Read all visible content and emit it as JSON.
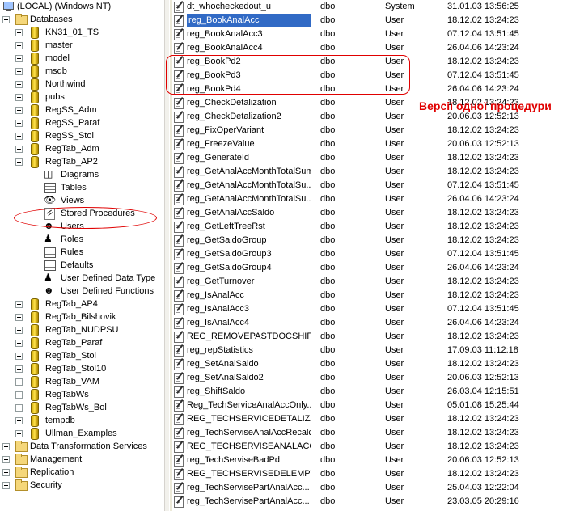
{
  "tree": {
    "items": [
      {
        "label": "(LOCAL) (Windows NT)",
        "icon": "monitor",
        "level": 0,
        "expander": "none"
      },
      {
        "label": "Databases",
        "icon": "folder",
        "level": 1,
        "expander": "minus"
      },
      {
        "label": "KN31_01_TS",
        "icon": "database",
        "level": 2,
        "expander": "plus"
      },
      {
        "label": "master",
        "icon": "database",
        "level": 2,
        "expander": "plus"
      },
      {
        "label": "model",
        "icon": "database",
        "level": 2,
        "expander": "plus"
      },
      {
        "label": "msdb",
        "icon": "database",
        "level": 2,
        "expander": "plus"
      },
      {
        "label": "Northwind",
        "icon": "database",
        "level": 2,
        "expander": "plus"
      },
      {
        "label": "pubs",
        "icon": "database",
        "level": 2,
        "expander": "plus"
      },
      {
        "label": "RegSS_Adm",
        "icon": "database",
        "level": 2,
        "expander": "plus"
      },
      {
        "label": "RegSS_Paraf",
        "icon": "database",
        "level": 2,
        "expander": "plus"
      },
      {
        "label": "RegSS_Stol",
        "icon": "database",
        "level": 2,
        "expander": "plus"
      },
      {
        "label": "RegTab_Adm",
        "icon": "database",
        "level": 2,
        "expander": "plus"
      },
      {
        "label": "RegTab_AP2",
        "icon": "database",
        "level": 2,
        "expander": "minus"
      },
      {
        "label": "Diagrams",
        "icon": "diagram",
        "level": 3,
        "expander": "none"
      },
      {
        "label": "Tables",
        "icon": "table",
        "level": 3,
        "expander": "none"
      },
      {
        "label": "Views",
        "icon": "views",
        "level": 3,
        "expander": "none"
      },
      {
        "label": "Stored Procedures",
        "icon": "stored-procedure",
        "level": 3,
        "expander": "none"
      },
      {
        "label": "Users",
        "icon": "users",
        "level": 3,
        "expander": "none"
      },
      {
        "label": "Roles",
        "icon": "roles",
        "level": 3,
        "expander": "none"
      },
      {
        "label": "Rules",
        "icon": "rules",
        "level": 3,
        "expander": "none"
      },
      {
        "label": "Defaults",
        "icon": "defaults",
        "level": 3,
        "expander": "none"
      },
      {
        "label": "User Defined Data Type",
        "icon": "udt",
        "level": 3,
        "expander": "none"
      },
      {
        "label": "User Defined Functions",
        "icon": "udf",
        "level": 3,
        "expander": "none"
      },
      {
        "label": "RegTab_AP4",
        "icon": "database",
        "level": 2,
        "expander": "plus"
      },
      {
        "label": "RegTab_Bilshovik",
        "icon": "database",
        "level": 2,
        "expander": "plus"
      },
      {
        "label": "RegTab_NUDPSU",
        "icon": "database",
        "level": 2,
        "expander": "plus"
      },
      {
        "label": "RegTab_Paraf",
        "icon": "database",
        "level": 2,
        "expander": "plus"
      },
      {
        "label": "RegTab_Stol",
        "icon": "database",
        "level": 2,
        "expander": "plus"
      },
      {
        "label": "RegTab_Stol10",
        "icon": "database",
        "level": 2,
        "expander": "plus"
      },
      {
        "label": "RegTab_VAM",
        "icon": "database",
        "level": 2,
        "expander": "plus"
      },
      {
        "label": "RegTabWs",
        "icon": "database",
        "level": 2,
        "expander": "plus"
      },
      {
        "label": "RegTabWs_Bol",
        "icon": "database",
        "level": 2,
        "expander": "plus"
      },
      {
        "label": "tempdb",
        "icon": "database",
        "level": 2,
        "expander": "plus"
      },
      {
        "label": "Ullman_Examples",
        "icon": "database",
        "level": 2,
        "expander": "plus"
      },
      {
        "label": "Data Transformation Services",
        "icon": "folder",
        "level": 1,
        "expander": "plus"
      },
      {
        "label": "Management",
        "icon": "folder",
        "level": 1,
        "expander": "plus"
      },
      {
        "label": "Replication",
        "icon": "folder",
        "level": 1,
        "expander": "plus"
      },
      {
        "label": "Security",
        "icon": "folder",
        "level": 1,
        "expander": "plus"
      }
    ]
  },
  "procedures": {
    "rows": [
      {
        "name": "dt_whocheckedout_u",
        "owner": "dbo",
        "type": "System",
        "created": "31.01.03 13:56:25"
      },
      {
        "name": "reg_BookAnalAcc",
        "owner": "dbo",
        "type": "User",
        "created": "18.12.02 13:24:23",
        "selected": true
      },
      {
        "name": "reg_BookAnalAcc3",
        "owner": "dbo",
        "type": "User",
        "created": "07.12.04 13:51:45"
      },
      {
        "name": "reg_BookAnalAcc4",
        "owner": "dbo",
        "type": "User",
        "created": "26.04.06 14:23:24"
      },
      {
        "name": "reg_BookPd2",
        "owner": "dbo",
        "type": "User",
        "created": "18.12.02 13:24:23"
      },
      {
        "name": "reg_BookPd3",
        "owner": "dbo",
        "type": "User",
        "created": "07.12.04 13:51:45"
      },
      {
        "name": "reg_BookPd4",
        "owner": "dbo",
        "type": "User",
        "created": "26.04.06 14:23:24"
      },
      {
        "name": "reg_CheckDetalization",
        "owner": "dbo",
        "type": "User",
        "created": "18.12.02 13:24:23"
      },
      {
        "name": "reg_CheckDetalization2",
        "owner": "dbo",
        "type": "User",
        "created": "20.06.03 12:52:13"
      },
      {
        "name": "reg_FixOperVariant",
        "owner": "dbo",
        "type": "User",
        "created": "18.12.02 13:24:23"
      },
      {
        "name": "reg_FreezeValue",
        "owner": "dbo",
        "type": "User",
        "created": "20.06.03 12:52:13"
      },
      {
        "name": "reg_GenerateId",
        "owner": "dbo",
        "type": "User",
        "created": "18.12.02 13:24:23"
      },
      {
        "name": "reg_GetAnalAccMonthTotalSum",
        "owner": "dbo",
        "type": "User",
        "created": "18.12.02 13:24:23"
      },
      {
        "name": "reg_GetAnalAccMonthTotalSu...",
        "owner": "dbo",
        "type": "User",
        "created": "07.12.04 13:51:45"
      },
      {
        "name": "reg_GetAnalAccMonthTotalSu...",
        "owner": "dbo",
        "type": "User",
        "created": "26.04.06 14:23:24"
      },
      {
        "name": "reg_GetAnalAccSaldo",
        "owner": "dbo",
        "type": "User",
        "created": "18.12.02 13:24:23"
      },
      {
        "name": "reg_GetLeftTreeRst",
        "owner": "dbo",
        "type": "User",
        "created": "18.12.02 13:24:23"
      },
      {
        "name": "reg_GetSaldoGroup",
        "owner": "dbo",
        "type": "User",
        "created": "18.12.02 13:24:23"
      },
      {
        "name": "reg_GetSaldoGroup3",
        "owner": "dbo",
        "type": "User",
        "created": "07.12.04 13:51:45"
      },
      {
        "name": "reg_GetSaldoGroup4",
        "owner": "dbo",
        "type": "User",
        "created": "26.04.06 14:23:24"
      },
      {
        "name": "reg_GetTurnover",
        "owner": "dbo",
        "type": "User",
        "created": "18.12.02 13:24:23"
      },
      {
        "name": "reg_IsAnalAcc",
        "owner": "dbo",
        "type": "User",
        "created": "18.12.02 13:24:23"
      },
      {
        "name": "reg_IsAnalAcc3",
        "owner": "dbo",
        "type": "User",
        "created": "07.12.04 13:51:45"
      },
      {
        "name": "reg_IsAnalAcc4",
        "owner": "dbo",
        "type": "User",
        "created": "26.04.06 14:23:24"
      },
      {
        "name": "REG_REMOVEPASTDOCSHIFT...",
        "owner": "dbo",
        "type": "User",
        "created": "18.12.02 13:24:23"
      },
      {
        "name": "reg_repStatistics",
        "owner": "dbo",
        "type": "User",
        "created": "17.09.03 11:12:18"
      },
      {
        "name": "reg_SetAnalSaldo",
        "owner": "dbo",
        "type": "User",
        "created": "18.12.02 13:24:23"
      },
      {
        "name": "reg_SetAnalSaldo2",
        "owner": "dbo",
        "type": "User",
        "created": "20.06.03 12:52:13"
      },
      {
        "name": "reg_ShiftSaldo",
        "owner": "dbo",
        "type": "User",
        "created": "26.03.04 12:15:51"
      },
      {
        "name": "Reg_TechServiceAnalAccOnly...",
        "owner": "dbo",
        "type": "User",
        "created": "05.01.08 15:25:44"
      },
      {
        "name": "REG_TECHSERVICEDETALIZA...",
        "owner": "dbo",
        "type": "User",
        "created": "18.12.02 13:24:23"
      },
      {
        "name": "reg_TechServiseAnalAccRecalc",
        "owner": "dbo",
        "type": "User",
        "created": "18.12.02 13:24:23"
      },
      {
        "name": "REG_TECHSERVISEANALACC...",
        "owner": "dbo",
        "type": "User",
        "created": "18.12.02 13:24:23"
      },
      {
        "name": "reg_TechServiseBadPd",
        "owner": "dbo",
        "type": "User",
        "created": "20.06.03 12:52:13"
      },
      {
        "name": "REG_TECHSERVISEDELEMPTY...",
        "owner": "dbo",
        "type": "User",
        "created": "18.12.02 13:24:23"
      },
      {
        "name": "reg_TechServisePartAnalAcc...",
        "owner": "dbo",
        "type": "User",
        "created": "25.04.03 12:22:04"
      },
      {
        "name": "reg_TechServisePartAnalAcc...",
        "owner": "dbo",
        "type": "User",
        "created": "23.03.05 20:29:16"
      }
    ]
  },
  "annotation": {
    "versions_label": "Версії одної процедури",
    "color": "#e00000"
  },
  "colors": {
    "selection": "#316ac5",
    "annotation": "#e00000"
  }
}
